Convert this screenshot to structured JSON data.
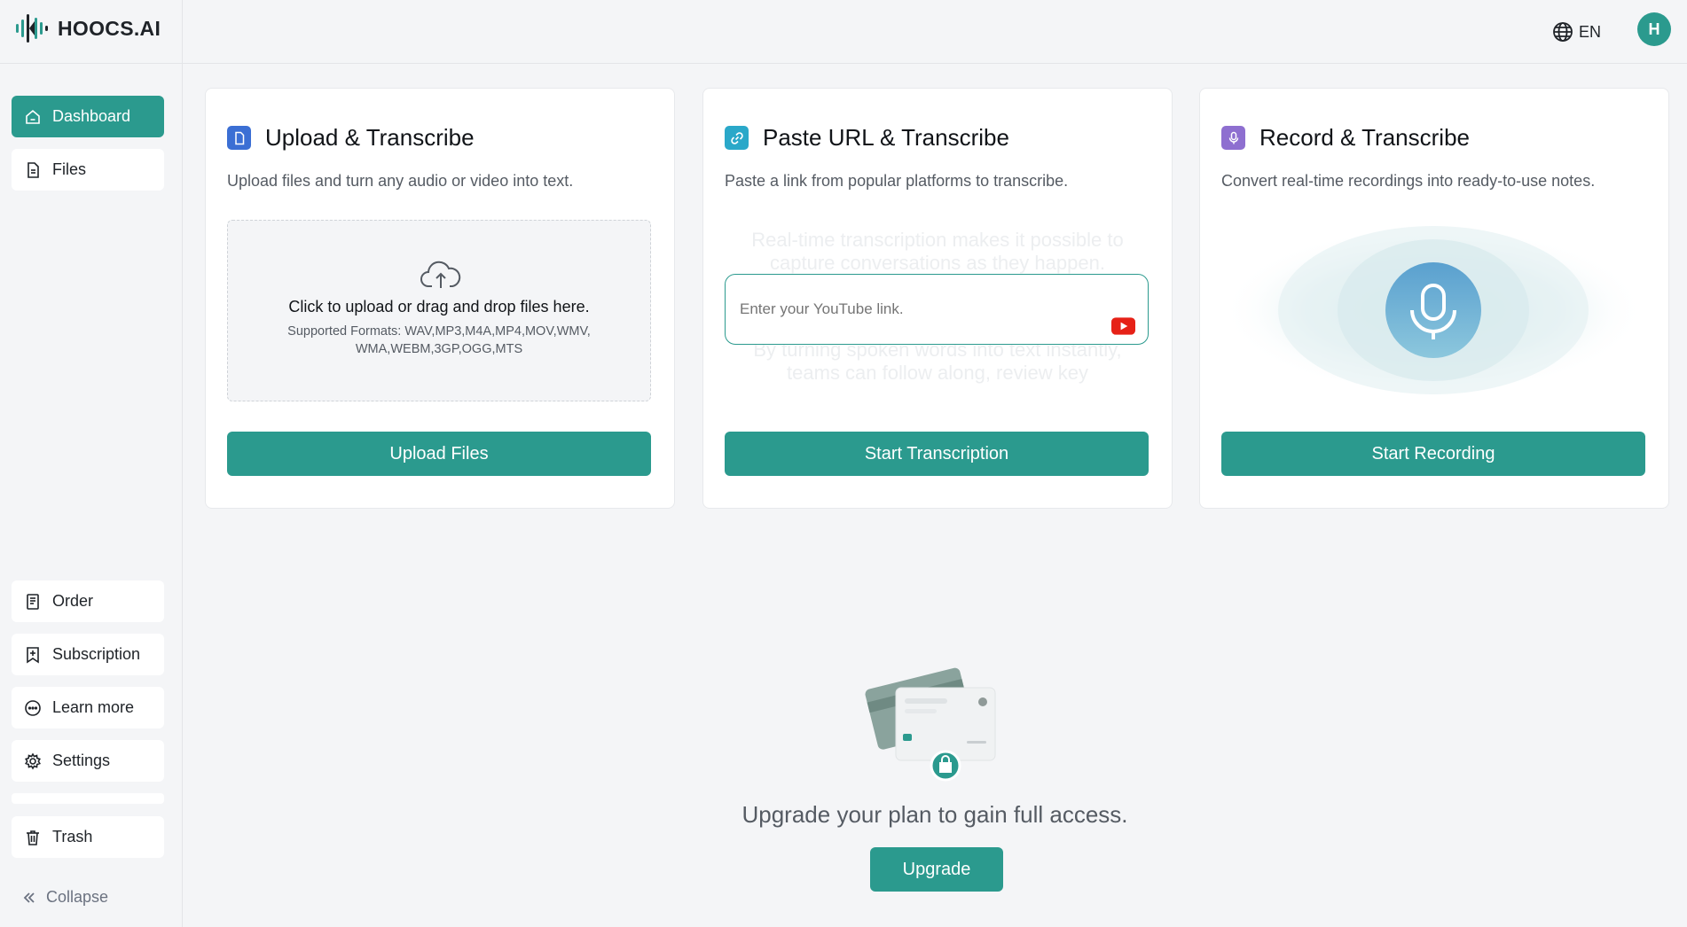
{
  "header": {
    "brand": "HOOCS.AI",
    "language": "EN",
    "avatar_initial": "H"
  },
  "sidebar": {
    "items": [
      {
        "label": "Dashboard",
        "icon": "home-icon",
        "active": true
      },
      {
        "label": "Files",
        "icon": "file-icon",
        "active": false
      },
      {
        "label": "Order",
        "icon": "order-icon",
        "active": false
      },
      {
        "label": "Subscription",
        "icon": "subscription-icon",
        "active": false
      },
      {
        "label": "Learn more",
        "icon": "more-icon",
        "active": false
      },
      {
        "label": "Settings",
        "icon": "gear-icon",
        "active": false
      },
      {
        "label": "Trash",
        "icon": "trash-icon",
        "active": false
      }
    ],
    "collapse_label": "Collapse"
  },
  "cards": {
    "upload": {
      "title": "Upload & Transcribe",
      "description": "Upload files and turn any audio or video into text.",
      "dropzone_main": "Click to upload or drag and drop files here.",
      "dropzone_formats": "Supported Formats: WAV,MP3,M4A,MP4,MOV,WMV, WMA,WEBM,3GP,OGG,MTS",
      "button": "Upload Files",
      "icon_color": "#3b6fd4"
    },
    "url": {
      "title": "Paste URL & Transcribe",
      "description": "Paste a link from popular platforms to transcribe.",
      "placeholder": "Enter your YouTube link.",
      "ghost_lines": [
        "Real-time transcription makes it possible to",
        "capture conversations as they happen.",
        "By turning spoken words into text instantly,",
        "teams can follow along, review key"
      ],
      "button": "Start Transcription",
      "icon_color": "#2aa8c9"
    },
    "record": {
      "title": "Record & Transcribe",
      "description": "Convert real-time recordings into ready-to-use notes.",
      "button": "Start Recording",
      "icon_color": "#8e6fd0"
    }
  },
  "upgrade": {
    "message": "Upgrade your plan to gain full access.",
    "button": "Upgrade"
  },
  "colors": {
    "accent": "#2b9a8e",
    "background": "#f4f5f7"
  }
}
